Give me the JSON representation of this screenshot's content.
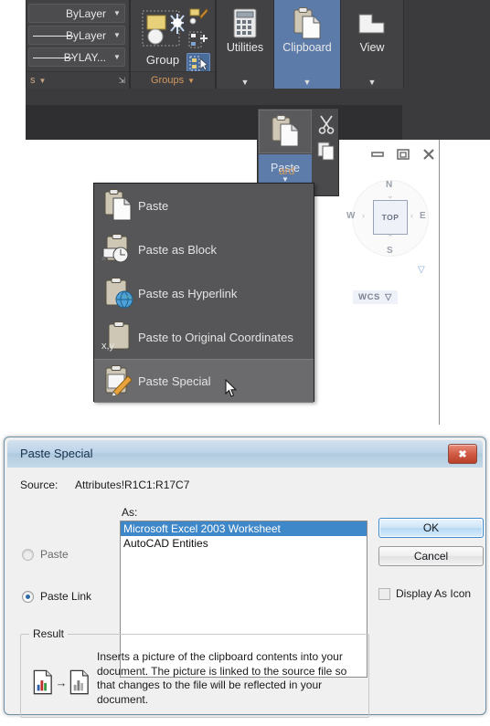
{
  "ribbon": {
    "properties_panel": {
      "title": "s",
      "rows": [
        {
          "label": "ByLayer",
          "has_line": false,
          "icon": "chevron-down-icon"
        },
        {
          "label": "ByLayer",
          "has_line": true,
          "icon": "chevron-down-icon"
        },
        {
          "label": "BYLAY...",
          "has_line": true,
          "icon": "chevron-down-icon"
        }
      ],
      "expand_glyph": "⇲"
    },
    "group_panel": {
      "big_label": "Group",
      "title": "Groups",
      "title_arrow": "▼",
      "buttons": [
        "group-icon",
        "edit-group-icon",
        "add-to-group-icon",
        "group-selection-on-icon"
      ]
    },
    "panels": [
      {
        "caption": "Utilities",
        "icon": "calculator-icon",
        "arrow": "▼",
        "selected": false
      },
      {
        "caption": "Clipboard",
        "icon": "clipboard-icon",
        "arrow": "▼",
        "selected": true
      },
      {
        "caption": "View",
        "icon": "view-icon",
        "arrow": "▼",
        "selected": false
      }
    ]
  },
  "paste_flyout": {
    "button_label": "Paste",
    "button_arrow": "▼",
    "panel_word": "ard",
    "tools": [
      "cut-icon",
      "copy-icon"
    ]
  },
  "viewport": {
    "controls": [
      "minimize-icon",
      "restore-icon",
      "close-icon"
    ],
    "viewcube": {
      "face": "TOP",
      "north": "N",
      "south": "S",
      "west": "W",
      "east": "E",
      "arrows": [
        "^",
        "v",
        "<",
        ">"
      ]
    },
    "wcs_label": "WCS",
    "wcs_arrow": "▽"
  },
  "paste_menu": {
    "items": [
      {
        "label": "Paste",
        "icon": "paste-icon",
        "selected": false
      },
      {
        "label": "Paste as Block",
        "icon": "paste-as-block-icon",
        "selected": false
      },
      {
        "label": "Paste as Hyperlink",
        "icon": "paste-as-hyperlink-icon",
        "selected": false
      },
      {
        "label": "Paste to Original Coordinates",
        "icon": "paste-to-original-coordinates-icon",
        "selected": false
      },
      {
        "label": "Paste Special",
        "icon": "paste-special-icon",
        "selected": true
      }
    ]
  },
  "dialog": {
    "title": "Paste Special",
    "close_glyph": "✖",
    "source_label": "Source:",
    "source_value": "Attributes!R1C1:R17C7",
    "as_label": "As:",
    "radios": [
      {
        "label": "Paste",
        "checked": false,
        "enabled": false
      },
      {
        "label": "Paste Link",
        "checked": true,
        "enabled": true
      }
    ],
    "as_options": [
      {
        "label": "Microsoft Excel 2003 Worksheet",
        "selected": true
      },
      {
        "label": "AutoCAD Entities",
        "selected": false
      }
    ],
    "ok_label": "OK",
    "cancel_label": "Cancel",
    "display_as_icon_label": "Display As Icon",
    "display_as_icon_checked": false,
    "result": {
      "legend": "Result",
      "icon": "document-link-document-icon",
      "text": "Inserts a picture of the clipboard contents into your document.  The picture is linked to the source file so that changes to the file will be reflected in your document."
    }
  },
  "colors": {
    "ribbon_bg": "#3b3b3d",
    "panel_bg": "#424244",
    "panel_selected": "#5c7ba8",
    "menu_bg": "#565658",
    "menu_selected": "#6b6b6d",
    "dialog_bg": "#f0f0f0",
    "list_selection": "#3e87c8",
    "title_text": "#d39a5e",
    "close_red": "#cf5842"
  }
}
